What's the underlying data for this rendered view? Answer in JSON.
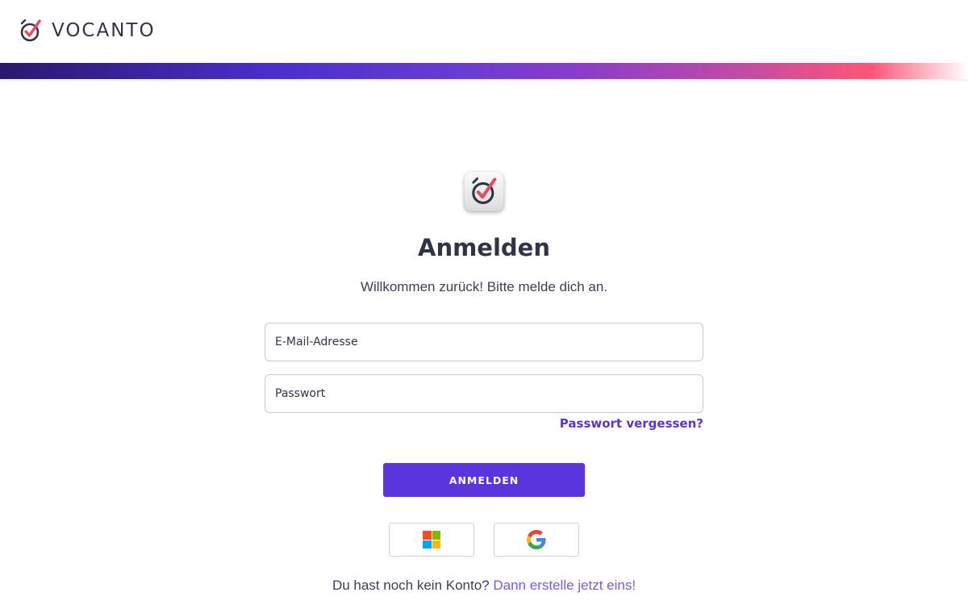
{
  "header": {
    "brand_name": "VOCANTO",
    "logo_icon": "alarm-clock-check-icon"
  },
  "colors": {
    "accent": "#5a34dd",
    "link": "#5b35c9",
    "brand_red": "#e84a5f",
    "text": "#2f3447"
  },
  "login": {
    "app_icon": "alarm-clock-check-icon",
    "title": "Anmelden",
    "subtitle": "Willkommen zurück! Bitte melde dich an.",
    "email_placeholder": "E-Mail-Adresse",
    "password_placeholder": "Passwort",
    "forgot_password": "Passwort vergessen?",
    "submit_label": "ANMELDEN",
    "sso": [
      {
        "provider": "microsoft-icon"
      },
      {
        "provider": "google-icon"
      }
    ],
    "signup_prompt": "Du hast noch kein Konto?",
    "signup_link": "Dann erstelle jetzt eins!"
  }
}
